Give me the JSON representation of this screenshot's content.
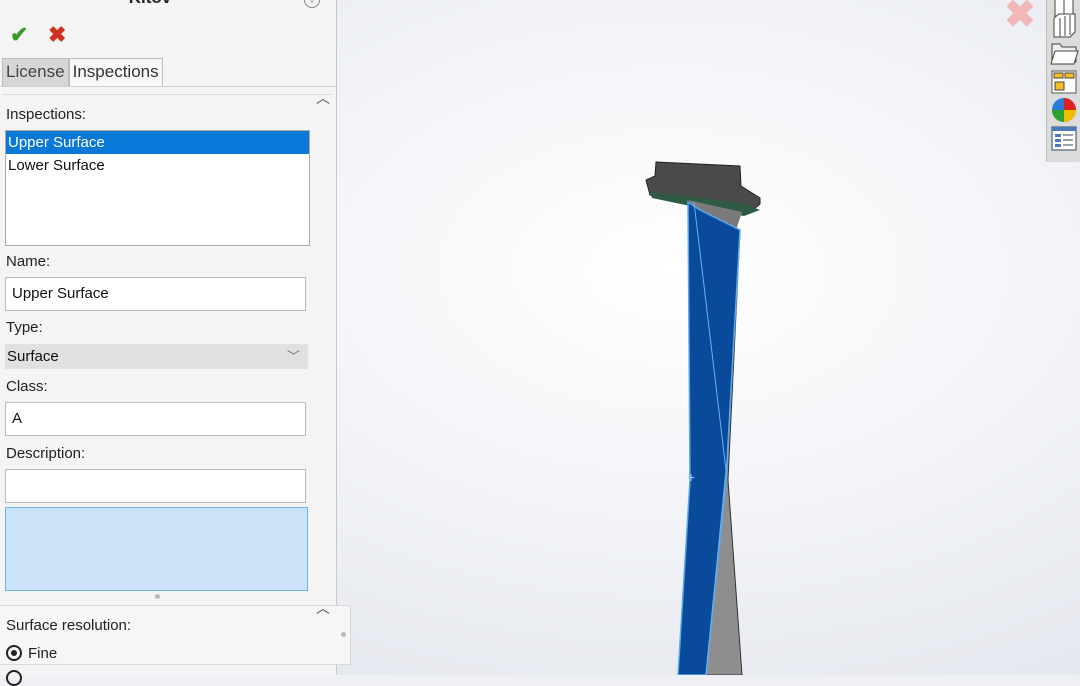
{
  "panel": {
    "title": "Kitov",
    "help_icon": "info-icon",
    "ok_icon": "checkmark-icon",
    "cancel_icon": "close-icon",
    "tabs": [
      {
        "label": "License",
        "active": false
      },
      {
        "label": "Inspections",
        "active": true
      }
    ],
    "inspections_label": "Inspections:",
    "inspections": [
      {
        "label": "Upper Surface",
        "selected": true
      },
      {
        "label": "Lower Surface",
        "selected": false
      }
    ],
    "name_label": "Name:",
    "name_value": "Upper Surface",
    "type_label": "Type:",
    "type_value": "Surface",
    "class_label": "Class:",
    "class_value": "A",
    "description_label": "Description:",
    "description_value": "",
    "surface_resolution_label": "Surface resolution:",
    "resolution_options": [
      {
        "label": "Fine",
        "selected": true
      }
    ]
  },
  "toolbar": {
    "icons": [
      "home-icon",
      "parts-library-icon",
      "folder-icon",
      "view-palette-icon",
      "appearances-icon",
      "custom-properties-icon"
    ]
  },
  "viewport": {
    "model": "turbine-blade",
    "highlight_color": "#0a4a9a",
    "faded_close_icon": "close-icon"
  }
}
